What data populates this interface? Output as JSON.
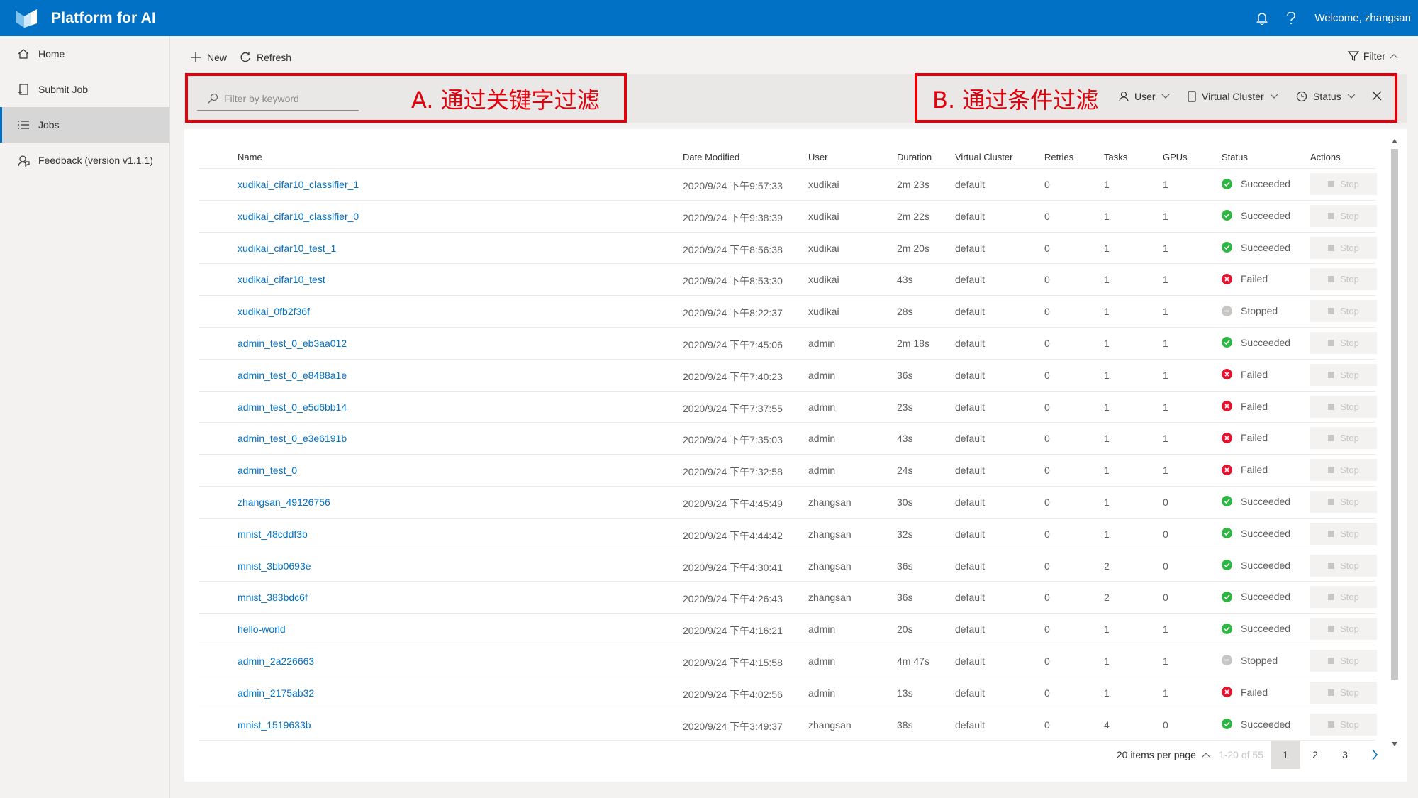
{
  "app": {
    "title": "Platform for AI"
  },
  "header": {
    "welcome": "Welcome, zhangsan",
    "bell_icon": "bell-icon",
    "help_icon": "help-icon",
    "brand_color": "#0071c5"
  },
  "sidebar": {
    "items": [
      {
        "label": "Home",
        "icon": "home-icon",
        "active": false
      },
      {
        "label": "Submit Job",
        "icon": "submit-icon",
        "active": false
      },
      {
        "label": "Jobs",
        "icon": "list-icon",
        "active": true
      },
      {
        "label": "Feedback (version v1.1.1)",
        "icon": "feedback-icon",
        "active": false
      }
    ]
  },
  "toolbar": {
    "new_label": "New",
    "refresh_label": "Refresh",
    "filter_label": "Filter"
  },
  "filters": {
    "keyword_placeholder": "Filter by keyword",
    "annotation_a": "A. 通过关键字过滤",
    "annotation_b": "B. 通过条件过滤",
    "user_label": "User",
    "vc_label": "Virtual Cluster",
    "status_label": "Status"
  },
  "table": {
    "columns": [
      "Name",
      "Date Modified",
      "User",
      "Duration",
      "Virtual Cluster",
      "Retries",
      "Tasks",
      "GPUs",
      "Status",
      "Actions"
    ],
    "stop_label": "Stop",
    "rows": [
      {
        "name": "xudikai_cifar10_classifier_1",
        "date": "2020/9/24 下午9:57:33",
        "user": "xudikai",
        "duration": "2m 23s",
        "vc": "default",
        "retries": "0",
        "tasks": "1",
        "gpus": "1",
        "status": "Succeeded"
      },
      {
        "name": "xudikai_cifar10_classifier_0",
        "date": "2020/9/24 下午9:38:39",
        "user": "xudikai",
        "duration": "2m 22s",
        "vc": "default",
        "retries": "0",
        "tasks": "1",
        "gpus": "1",
        "status": "Succeeded"
      },
      {
        "name": "xudikai_cifar10_test_1",
        "date": "2020/9/24 下午8:56:38",
        "user": "xudikai",
        "duration": "2m 20s",
        "vc": "default",
        "retries": "0",
        "tasks": "1",
        "gpus": "1",
        "status": "Succeeded"
      },
      {
        "name": "xudikai_cifar10_test",
        "date": "2020/9/24 下午8:53:30",
        "user": "xudikai",
        "duration": "43s",
        "vc": "default",
        "retries": "0",
        "tasks": "1",
        "gpus": "1",
        "status": "Failed"
      },
      {
        "name": "xudikai_0fb2f36f",
        "date": "2020/9/24 下午8:22:37",
        "user": "xudikai",
        "duration": "28s",
        "vc": "default",
        "retries": "0",
        "tasks": "1",
        "gpus": "1",
        "status": "Stopped"
      },
      {
        "name": "admin_test_0_eb3aa012",
        "date": "2020/9/24 下午7:45:06",
        "user": "admin",
        "duration": "2m 18s",
        "vc": "default",
        "retries": "0",
        "tasks": "1",
        "gpus": "1",
        "status": "Succeeded"
      },
      {
        "name": "admin_test_0_e8488a1e",
        "date": "2020/9/24 下午7:40:23",
        "user": "admin",
        "duration": "36s",
        "vc": "default",
        "retries": "0",
        "tasks": "1",
        "gpus": "1",
        "status": "Failed"
      },
      {
        "name": "admin_test_0_e5d6bb14",
        "date": "2020/9/24 下午7:37:55",
        "user": "admin",
        "duration": "23s",
        "vc": "default",
        "retries": "0",
        "tasks": "1",
        "gpus": "1",
        "status": "Failed"
      },
      {
        "name": "admin_test_0_e3e6191b",
        "date": "2020/9/24 下午7:35:03",
        "user": "admin",
        "duration": "43s",
        "vc": "default",
        "retries": "0",
        "tasks": "1",
        "gpus": "1",
        "status": "Failed"
      },
      {
        "name": "admin_test_0",
        "date": "2020/9/24 下午7:32:58",
        "user": "admin",
        "duration": "24s",
        "vc": "default",
        "retries": "0",
        "tasks": "1",
        "gpus": "1",
        "status": "Failed"
      },
      {
        "name": "zhangsan_49126756",
        "date": "2020/9/24 下午4:45:49",
        "user": "zhangsan",
        "duration": "30s",
        "vc": "default",
        "retries": "0",
        "tasks": "1",
        "gpus": "0",
        "status": "Succeeded"
      },
      {
        "name": "mnist_48cddf3b",
        "date": "2020/9/24 下午4:44:42",
        "user": "zhangsan",
        "duration": "32s",
        "vc": "default",
        "retries": "0",
        "tasks": "1",
        "gpus": "0",
        "status": "Succeeded"
      },
      {
        "name": "mnist_3bb0693e",
        "date": "2020/9/24 下午4:30:41",
        "user": "zhangsan",
        "duration": "36s",
        "vc": "default",
        "retries": "0",
        "tasks": "2",
        "gpus": "0",
        "status": "Succeeded"
      },
      {
        "name": "mnist_383bdc6f",
        "date": "2020/9/24 下午4:26:43",
        "user": "zhangsan",
        "duration": "36s",
        "vc": "default",
        "retries": "0",
        "tasks": "2",
        "gpus": "0",
        "status": "Succeeded"
      },
      {
        "name": "hello-world",
        "date": "2020/9/24 下午4:16:21",
        "user": "admin",
        "duration": "20s",
        "vc": "default",
        "retries": "0",
        "tasks": "1",
        "gpus": "1",
        "status": "Succeeded"
      },
      {
        "name": "admin_2a226663",
        "date": "2020/9/24 下午4:15:58",
        "user": "admin",
        "duration": "4m 47s",
        "vc": "default",
        "retries": "0",
        "tasks": "1",
        "gpus": "1",
        "status": "Stopped"
      },
      {
        "name": "admin_2175ab32",
        "date": "2020/9/24 下午4:02:56",
        "user": "admin",
        "duration": "13s",
        "vc": "default",
        "retries": "0",
        "tasks": "1",
        "gpus": "1",
        "status": "Failed"
      },
      {
        "name": "mnist_1519633b",
        "date": "2020/9/24 下午3:49:37",
        "user": "zhangsan",
        "duration": "38s",
        "vc": "default",
        "retries": "0",
        "tasks": "4",
        "gpus": "0",
        "status": "Succeeded"
      }
    ]
  },
  "pagination": {
    "per_page_label": "20 items per page",
    "range": "1-20 of 55",
    "pages": [
      "1",
      "2",
      "3"
    ],
    "current_page": "1"
  },
  "status_colors": {
    "Succeeded": "#2db642",
    "Failed": "#e3122f",
    "Stopped": "#c8c6c4"
  }
}
